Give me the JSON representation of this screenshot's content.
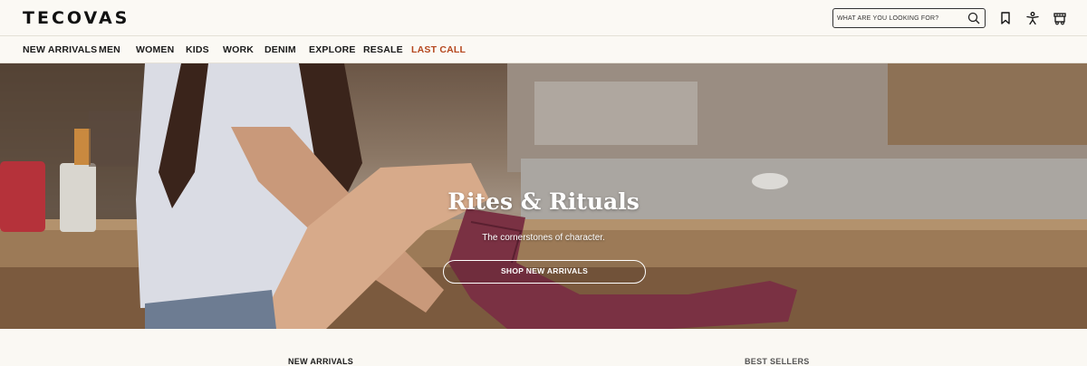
{
  "header": {
    "logo": "TECOVAS",
    "search_placeholder": "WHAT ARE YOU LOOKING FOR?",
    "icons": [
      "search-icon",
      "bookmark-icon",
      "account-icon",
      "cart-icon"
    ]
  },
  "nav": {
    "items": [
      "NEW ARRIVALS",
      "MEN",
      "WOMEN",
      "KIDS",
      "WORK",
      "DENIM",
      "EXPLORE",
      "RESALE",
      "LAST CALL"
    ],
    "sale_color": "#b5471e"
  },
  "hero": {
    "title": "Rites & Rituals",
    "subtitle": "The cornerstones of character.",
    "cta": "SHOP NEW ARRIVALS"
  },
  "sections": {
    "left": "NEW ARRIVALS",
    "right": "BEST SELLERS"
  }
}
